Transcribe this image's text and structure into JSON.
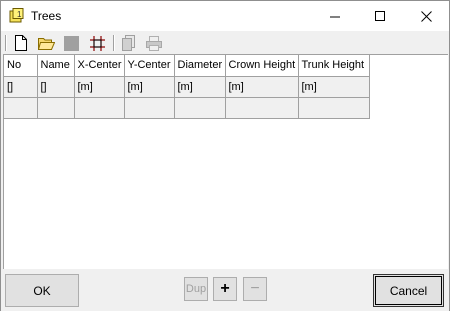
{
  "window": {
    "title": "Trees"
  },
  "titlebar_icons": [
    "app-icon",
    "minimize-icon",
    "maximize-icon",
    "close-icon"
  ],
  "toolbar_icons": [
    "new-file-icon",
    "open-folder-icon",
    "save-icon-disabled",
    "grid-icon",
    "copy-icon-disabled",
    "print-icon-disabled"
  ],
  "grid": {
    "headers": [
      "No",
      "Name",
      "X-Center",
      "Y-Center",
      "Diameter",
      "Crown Height",
      "Trunk Height"
    ],
    "units": [
      "[]",
      "[]",
      "[m]",
      "[m]",
      "[m]",
      "[m]",
      "[m]"
    ]
  },
  "buttons": {
    "ok": "OK",
    "dup": "Dup",
    "add": "+",
    "remove": "−",
    "cancel": "Cancel"
  }
}
